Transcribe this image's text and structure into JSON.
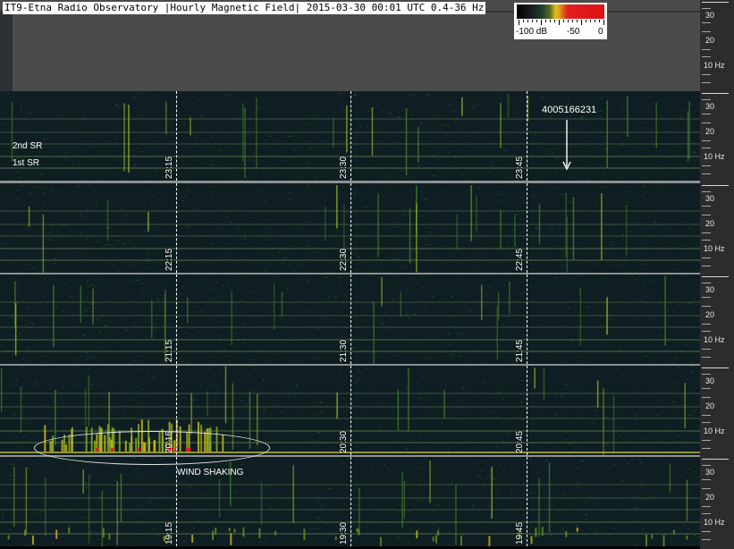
{
  "title": "IT9-Etna Radio Observatory |Hourly Magnetic Field| 2015-03-30 00:01 UTC 0.4-36 Hz",
  "colorbar": {
    "labels": [
      "-100 dB",
      "-50",
      "0"
    ]
  },
  "scale_labels": [
    "30",
    "20",
    "10 Hz"
  ],
  "rows": [
    {
      "times": [
        "23:15",
        "23:30",
        "23:45"
      ]
    },
    {
      "times": [
        "22:15",
        "22:30",
        "22:45"
      ]
    },
    {
      "times": [
        "21:15",
        "21:30",
        "21:45"
      ]
    },
    {
      "times": [
        "20:15",
        "20:30",
        "20:45"
      ]
    },
    {
      "times": [
        "19:15",
        "19:30",
        "19:45"
      ]
    }
  ],
  "annotations": {
    "second_sr": "2nd SR",
    "first_sr": "1st SR",
    "id_number": "4005166231",
    "wind_shaking": "WIND SHAKING"
  },
  "colors": {
    "header_bg": "#4b4b4b",
    "spectrogram_bg": "#0f1e22",
    "signal_green": "#3f7a2a",
    "signal_yellow": "#d6c11a",
    "signal_red": "#e02020"
  }
}
